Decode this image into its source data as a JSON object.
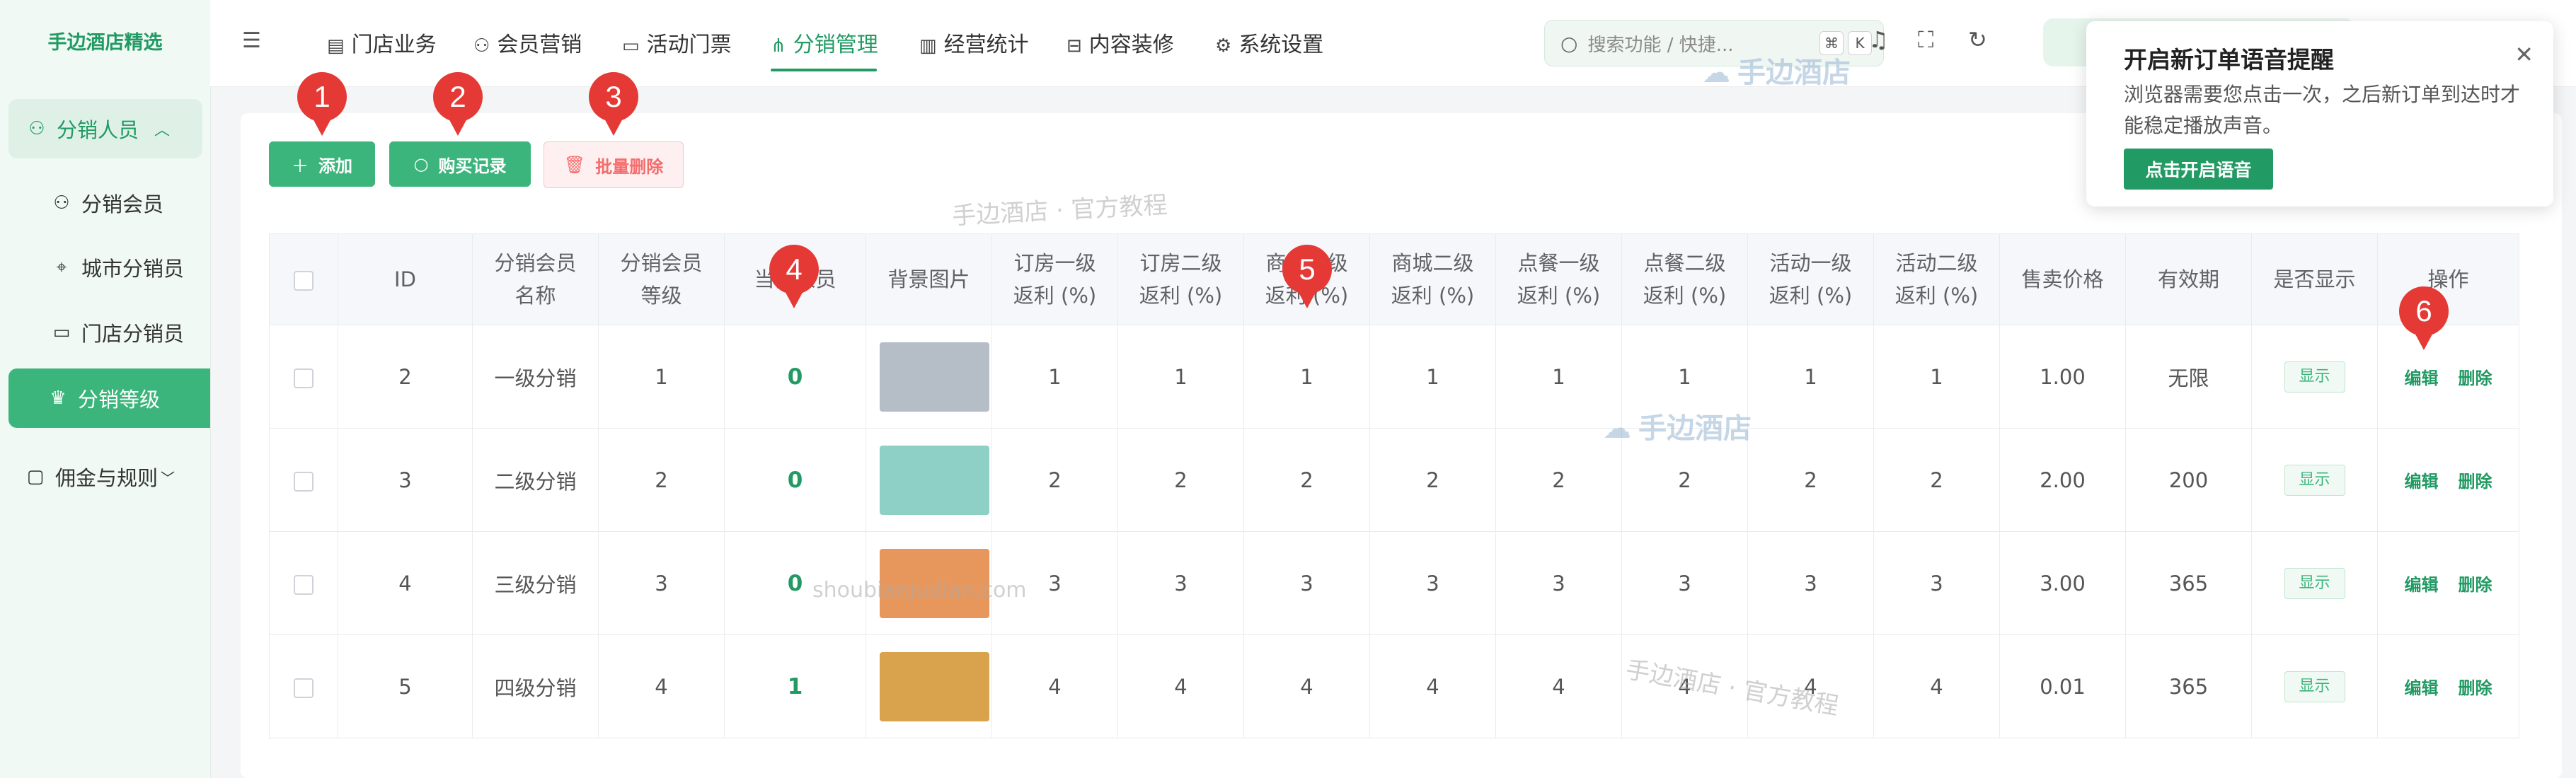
{
  "sidebar": {
    "logo": "手边酒店精选",
    "group": {
      "label": "分销人员"
    },
    "items": [
      {
        "label": "分销会员"
      },
      {
        "label": "城市分销员"
      },
      {
        "label": "门店分销员"
      },
      {
        "label": "分销等级"
      }
    ],
    "bottom_group": {
      "label": "佣金与规则"
    }
  },
  "header": {
    "tabs": [
      {
        "label": "门店业务"
      },
      {
        "label": "会员营销"
      },
      {
        "label": "活动门票"
      },
      {
        "label": "分销管理"
      },
      {
        "label": "经营统计"
      },
      {
        "label": "内容装修"
      },
      {
        "label": "系统设置"
      }
    ],
    "search_placeholder": "搜索功能 / 快捷...",
    "kbd1": "⌘",
    "kbd2": "K"
  },
  "toolbar": {
    "add_label": "添加",
    "purchase_label": "购买记录",
    "batch_delete_label": "批量删除"
  },
  "table": {
    "headers": [
      "ID",
      "分销会员\n名称",
      "分销会员\n等级",
      "当前人员",
      "背景图片",
      "订房一级\n返利 (%)",
      "订房二级\n返利 (%)",
      "商城一级\n返利 (%)",
      "商城二级\n返利 (%)",
      "点餐一级\n返利 (%)",
      "点餐二级\n返利 (%)",
      "活动一级\n返利 (%)",
      "活动二级\n返利 (%)",
      "售卖价格",
      "有效期",
      "是否显示",
      "操作"
    ],
    "rows": [
      {
        "id": "2",
        "name": "一级分销",
        "level": "1",
        "count": "0",
        "thumb": "#b5bdc6",
        "r1": "1",
        "r2": "1",
        "r3": "1",
        "r4": "1",
        "r5": "1",
        "r6": "1",
        "r7": "1",
        "r8": "1",
        "price": "1.00",
        "validity": "无限",
        "show": "显示"
      },
      {
        "id": "3",
        "name": "二级分销",
        "level": "2",
        "count": "0",
        "thumb": "#8fd0c6",
        "r1": "2",
        "r2": "2",
        "r3": "2",
        "r4": "2",
        "r5": "2",
        "r6": "2",
        "r7": "2",
        "r8": "2",
        "price": "2.00",
        "validity": "200",
        "show": "显示"
      },
      {
        "id": "4",
        "name": "三级分销",
        "level": "3",
        "count": "0",
        "thumb": "#e8975c",
        "r1": "3",
        "r2": "3",
        "r3": "3",
        "r4": "3",
        "r5": "3",
        "r6": "3",
        "r7": "3",
        "r8": "3",
        "price": "3.00",
        "validity": "365",
        "show": "显示"
      },
      {
        "id": "5",
        "name": "四级分销",
        "level": "4",
        "count": "1",
        "thumb": "#d9a24c",
        "r1": "4",
        "r2": "4",
        "r3": "4",
        "r4": "4",
        "r5": "4",
        "r6": "4",
        "r7": "4",
        "r8": "4",
        "price": "0.01",
        "validity": "365",
        "show": "显示"
      }
    ],
    "edit_label": "编辑",
    "delete_label": "删除"
  },
  "popup": {
    "title": "开启新订单语音提醒",
    "body": "浏览器需要您点击一次，之后新订单到达时才能稳定播放声音。",
    "button": "点击开启语音"
  },
  "watermarks": {
    "brand": "手边酒店",
    "tutorial": "手边酒店 · 官方教程",
    "domain": "shoubianjudian.com"
  },
  "markers": [
    "1",
    "2",
    "3",
    "4",
    "5",
    "6"
  ]
}
